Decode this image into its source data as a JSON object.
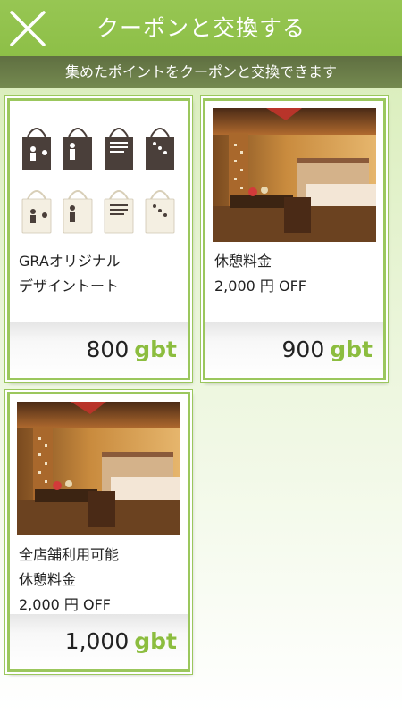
{
  "header": {
    "title": "クーポンと交換する"
  },
  "subheader": {
    "text": "集めたポイントをクーポンと交換できます"
  },
  "coupons": [
    {
      "name_lines": [
        "GRAオリジナル",
        "デザイントート"
      ],
      "price": "800",
      "unit": "gbt"
    },
    {
      "name_lines": [
        "休憩料金",
        "2,000 円 OFF"
      ],
      "price": "900",
      "unit": "gbt"
    },
    {
      "name_lines": [
        "全店舗利用可能",
        "休憩料金",
        "2,000 円 OFF"
      ],
      "price": "1,000",
      "unit": "gbt"
    }
  ],
  "colors": {
    "header_green": "#8dbf47",
    "accent_green": "#8cbd3f",
    "subheader_olive": "#6a7c48"
  }
}
